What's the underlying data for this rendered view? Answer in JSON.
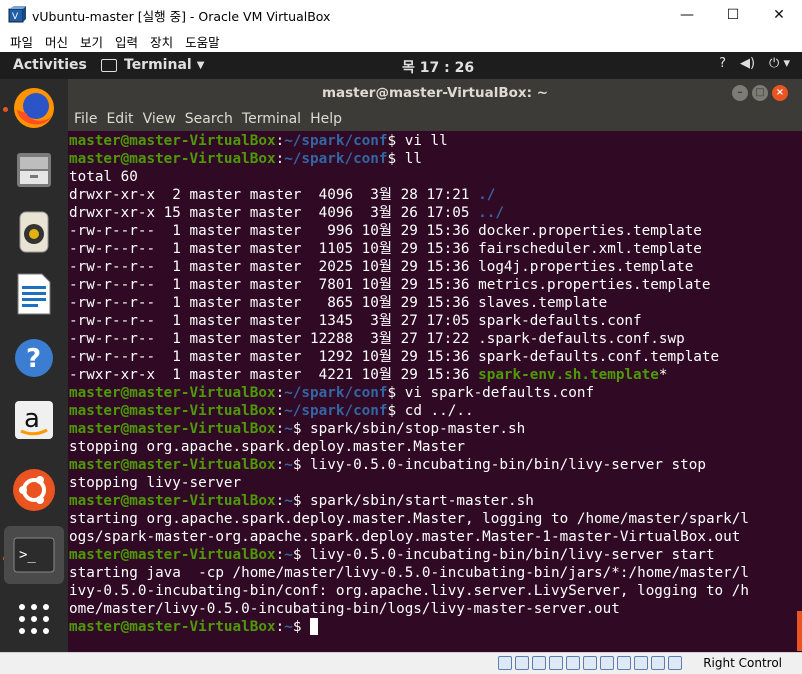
{
  "window": {
    "title": "vUbuntu-master [실행 중] - Oracle VM VirtualBox",
    "minimize": "—",
    "maximize": "☐",
    "close": "✕"
  },
  "vbox_menu": [
    "파일",
    "머신",
    "보기",
    "입력",
    "장치",
    "도움말"
  ],
  "top_panel": {
    "activities": "Activities",
    "app_name": "Terminal",
    "clock": "목 17 : 26"
  },
  "dock": {
    "icons": [
      "firefox-icon",
      "files-icon",
      "rhythmbox-icon",
      "writer-icon",
      "help-icon",
      "amazon-icon",
      "ubuntu-software-icon",
      "terminal-icon",
      "show-apps-icon"
    ]
  },
  "terminal": {
    "title": "master@master-VirtualBox: ~",
    "menu": [
      "File",
      "Edit",
      "View",
      "Search",
      "Terminal",
      "Help"
    ],
    "prompt_user": "master@master-VirtualBox",
    "lines": [
      {
        "type": "prompt",
        "path": "~/spark/conf",
        "cmd": " vi ll"
      },
      {
        "type": "prompt",
        "path": "~/spark/conf",
        "cmd": " ll"
      },
      {
        "type": "out",
        "text": "total 60"
      },
      {
        "type": "ls",
        "meta": "drwxr-xr-x  2 master master  4096  3월 28 17:21 ",
        "name": "./",
        "style": "dir",
        "suffix": ""
      },
      {
        "type": "ls",
        "meta": "drwxr-xr-x 15 master master  4096  3월 26 17:05 ",
        "name": "../",
        "style": "dir",
        "suffix": ""
      },
      {
        "type": "ls",
        "meta": "-rw-r--r--  1 master master   996 10월 29 15:36 ",
        "name": "docker.properties.template",
        "style": "plain",
        "suffix": ""
      },
      {
        "type": "ls",
        "meta": "-rw-r--r--  1 master master  1105 10월 29 15:36 ",
        "name": "fairscheduler.xml.template",
        "style": "plain",
        "suffix": ""
      },
      {
        "type": "ls",
        "meta": "-rw-r--r--  1 master master  2025 10월 29 15:36 ",
        "name": "log4j.properties.template",
        "style": "plain",
        "suffix": ""
      },
      {
        "type": "ls",
        "meta": "-rw-r--r--  1 master master  7801 10월 29 15:36 ",
        "name": "metrics.properties.template",
        "style": "plain",
        "suffix": ""
      },
      {
        "type": "ls",
        "meta": "-rw-r--r--  1 master master   865 10월 29 15:36 ",
        "name": "slaves.template",
        "style": "plain",
        "suffix": ""
      },
      {
        "type": "ls",
        "meta": "-rw-r--r--  1 master master  1345  3월 27 17:05 ",
        "name": "spark-defaults.conf",
        "style": "plain",
        "suffix": ""
      },
      {
        "type": "ls",
        "meta": "-rw-r--r--  1 master master 12288  3월 27 17:22 ",
        "name": ".spark-defaults.conf.swp",
        "style": "plain",
        "suffix": ""
      },
      {
        "type": "ls",
        "meta": "-rw-r--r--  1 master master  1292 10월 29 15:36 ",
        "name": "spark-defaults.conf.template",
        "style": "plain",
        "suffix": ""
      },
      {
        "type": "ls",
        "meta": "-rwxr-xr-x  1 master master  4221 10월 29 15:36 ",
        "name": "spark-env.sh.template",
        "style": "exec",
        "suffix": "*"
      },
      {
        "type": "prompt",
        "path": "~/spark/conf",
        "cmd": " vi spark-defaults.conf"
      },
      {
        "type": "prompt",
        "path": "~/spark/conf",
        "cmd": " cd ../.."
      },
      {
        "type": "prompt",
        "path": "~",
        "cmd": " spark/sbin/stop-master.sh"
      },
      {
        "type": "out",
        "text": "stopping org.apache.spark.deploy.master.Master"
      },
      {
        "type": "prompt",
        "path": "~",
        "cmd": " livy-0.5.0-incubating-bin/bin/livy-server stop"
      },
      {
        "type": "out",
        "text": "stopping livy-server"
      },
      {
        "type": "prompt",
        "path": "~",
        "cmd": " spark/sbin/start-master.sh"
      },
      {
        "type": "out",
        "text": "starting org.apache.spark.deploy.master.Master, logging to /home/master/spark/l"
      },
      {
        "type": "out",
        "text": "ogs/spark-master-org.apache.spark.deploy.master.Master-1-master-VirtualBox.out"
      },
      {
        "type": "prompt",
        "path": "~",
        "cmd": " livy-0.5.0-incubating-bin/bin/livy-server start"
      },
      {
        "type": "out",
        "text": "starting java  -cp /home/master/livy-0.5.0-incubating-bin/jars/*:/home/master/l"
      },
      {
        "type": "out",
        "text": "ivy-0.5.0-incubating-bin/conf: org.apache.livy.server.LivyServer, logging to /h"
      },
      {
        "type": "out",
        "text": "ome/master/livy-0.5.0-incubating-bin/logs/livy-master-server.out"
      },
      {
        "type": "prompt",
        "path": "~",
        "cmd": " ",
        "cursor": true
      }
    ]
  },
  "statusbar": {
    "host_key": "Right Control"
  }
}
